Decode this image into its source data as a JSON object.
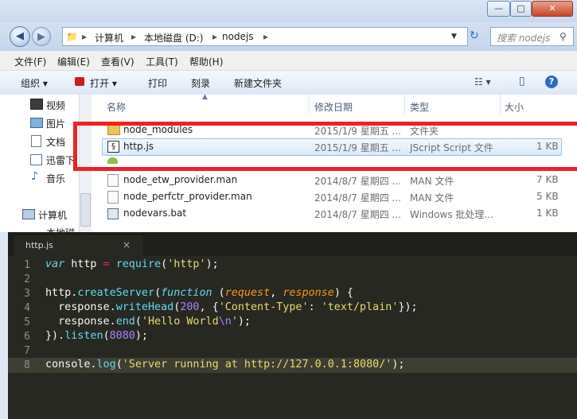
{
  "window": {
    "buttons": {
      "minimize": "—",
      "maximize": "□",
      "close": "✕"
    }
  },
  "address": {
    "back": "◀",
    "forward": "▶",
    "crumbs": [
      "计算机",
      "本地磁盘 (D:)",
      "nodejs"
    ],
    "sep": "▸",
    "search_placeholder": "搜索 nodejs"
  },
  "menu": [
    "文件(F)",
    "编辑(E)",
    "查看(V)",
    "工具(T)",
    "帮助(H)"
  ],
  "toolbar": {
    "organize": "组织 ▾",
    "open": "打开 ▾",
    "print": "打印",
    "burn": "刻录",
    "new_folder": "新建文件夹",
    "view": "☷ ▾",
    "pane": "▯",
    "help": "?"
  },
  "nav": {
    "items": [
      "视频",
      "图片",
      "文档",
      "迅雷下",
      "音乐",
      "计算机",
      "本地磁"
    ]
  },
  "columns": {
    "name": "名称",
    "modified": "修改日期",
    "type": "类型",
    "size": "大小"
  },
  "files": [
    {
      "name": "node_modules",
      "date": "2015/1/9 星期五 ...",
      "type": "文件夹",
      "size": ""
    },
    {
      "name": "http.js",
      "date": "2015/1/9 星期五 ...",
      "type": "JScript Script 文件",
      "size": "1 KB"
    },
    {
      "name": "node_etw_provider.man",
      "date": "2014/8/7 星期四 ...",
      "type": "MAN 文件",
      "size": "7 KB"
    },
    {
      "name": "node_perfctr_provider.man",
      "date": "2014/8/7 星期四 ...",
      "type": "MAN 文件",
      "size": "5 KB"
    },
    {
      "name": "nodevars.bat",
      "date": "2014/8/7 星期四 ...",
      "type": "Windows 批处理...",
      "size": "1 KB"
    }
  ],
  "editor": {
    "tab_title": "http.js",
    "tab_close": "×",
    "line_numbers": [
      "1",
      "2",
      "3",
      "4",
      "5",
      "6",
      "7",
      "8"
    ]
  },
  "colors": {
    "highlight_box": "#ee2222",
    "editor_bg": "#272822"
  }
}
